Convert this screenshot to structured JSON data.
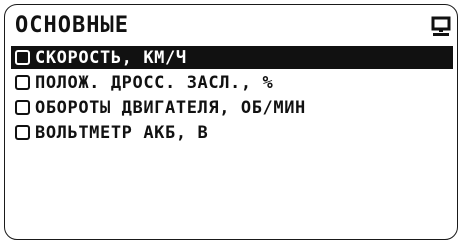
{
  "screen": {
    "title": "ОСНОВНЫЕ",
    "menu_icon": "display-menu-icon"
  },
  "parameters": [
    {
      "label": "СКОРОСТЬ, КМ/Ч",
      "selected": true
    },
    {
      "label": "ПОЛОЖ. ДРОСС. ЗАСЛ., %",
      "selected": false
    },
    {
      "label": "ОБОРОТЫ ДВИГАТЕЛЯ, ОБ/МИН",
      "selected": false
    },
    {
      "label": "ВОЛЬТМЕТР АКБ, В",
      "selected": false
    }
  ]
}
